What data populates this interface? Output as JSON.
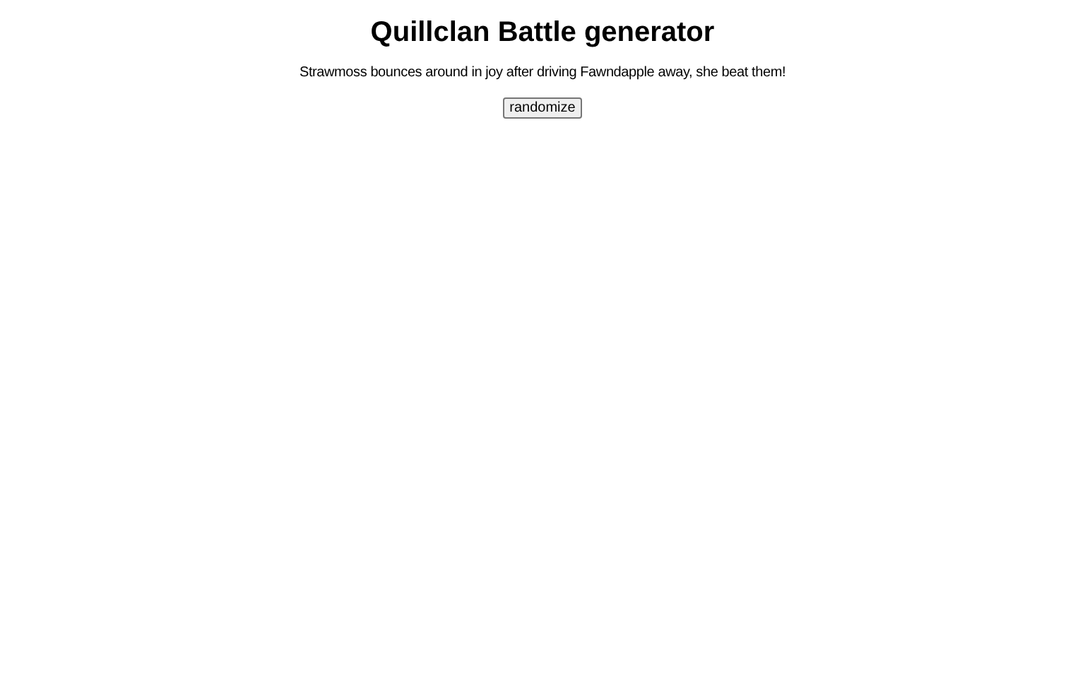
{
  "title": "Quillclan Battle generator",
  "sentence": "Strawmoss bounces around in joy after driving Fawndapple away, she beat them!",
  "button": "randomize"
}
